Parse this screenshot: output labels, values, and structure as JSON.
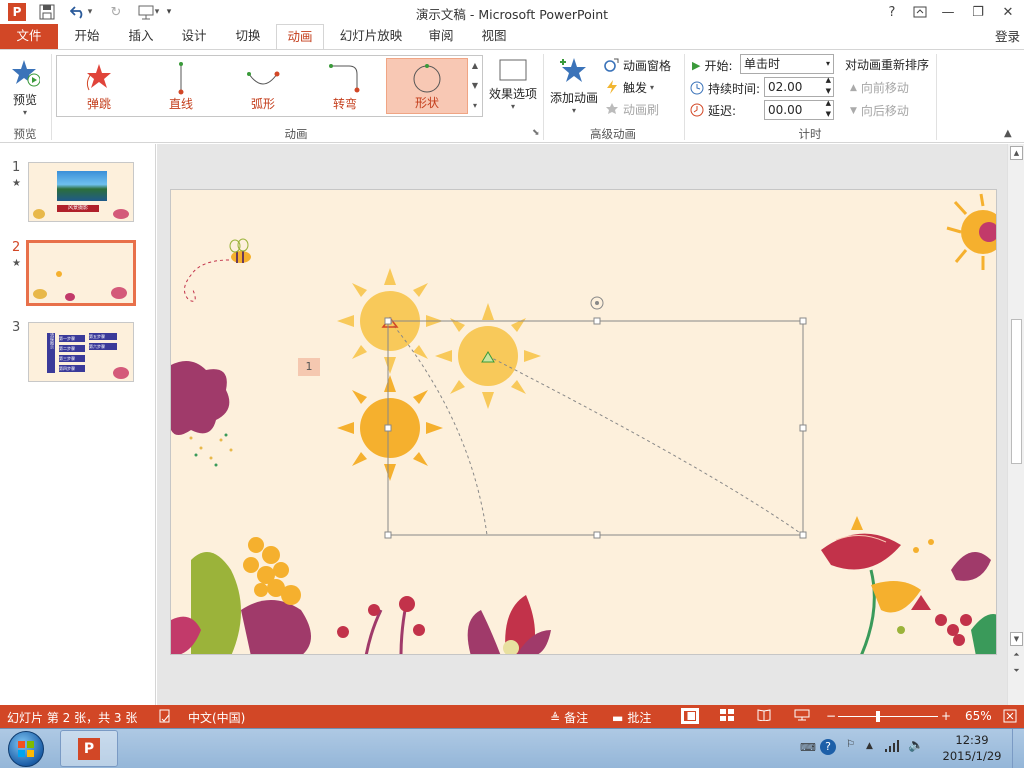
{
  "window": {
    "title": "演示文稿 - Microsoft PowerPoint",
    "help": "?",
    "minimize": "—",
    "restore": "❐",
    "close": "✕"
  },
  "qat": {
    "app_icon": "P",
    "save": "💾",
    "undo": "↶",
    "redo": "↻",
    "more": "▾"
  },
  "tabs": [
    "文件",
    "开始",
    "插入",
    "设计",
    "切换",
    "动画",
    "幻灯片放映",
    "审阅",
    "视图"
  ],
  "active_tab": "动画",
  "login": "登录",
  "ribbon": {
    "preview_label": "预览",
    "preview_group": "预览",
    "gallery": [
      {
        "label": "弹跳",
        "icon": "bounce-icon"
      },
      {
        "label": "直线",
        "icon": "line-path-icon"
      },
      {
        "label": "弧形",
        "icon": "arc-path-icon"
      },
      {
        "label": "转弯",
        "icon": "turn-path-icon"
      },
      {
        "label": "形状",
        "icon": "shape-path-icon"
      }
    ],
    "selected_gallery": "形状",
    "effect_options": "效果选项",
    "animation_group": "动画",
    "add_animation": "添加动画",
    "animation_pane": "动画窗格",
    "trigger": "触发",
    "animation_painter": "动画刷",
    "advanced_group": "高级动画",
    "start_label": "开始:",
    "start_value": "单击时",
    "duration_label": "持续时间:",
    "duration_value": "02.00",
    "delay_label": "延迟:",
    "delay_value": "00.00",
    "timing_group": "计时",
    "reorder_title": "对动画重新排序",
    "move_earlier": "向前移动",
    "move_later": "向后移动"
  },
  "slides": [
    {
      "number": "1",
      "star": "★",
      "banner": "风景摄影"
    },
    {
      "number": "2",
      "star": "★"
    },
    {
      "number": "3",
      "star": ""
    }
  ],
  "slide3_boxes": [
    "流程图示",
    "第一步骤",
    "第二步骤",
    "第三步骤",
    "第四步骤",
    "第五步骤",
    "第六步骤"
  ],
  "selected_slide": 2,
  "slide": {
    "anim_tag": "1"
  },
  "statusbar": {
    "slide_info": "幻灯片 第 2 张，共 3 张",
    "language": "中文(中国)",
    "notes": "备注",
    "comments": "批注",
    "zoom": "65%",
    "zoom_minus": "−",
    "zoom_plus": "+",
    "zoom_fraction": 0.4
  },
  "taskbar": {
    "time": "12:39",
    "date": "2015/1/29",
    "pp_icon": "P"
  },
  "colors": {
    "accent": "#d24726",
    "sun": "#f5b02e",
    "sun_light": "#f8c95a",
    "slide_bg": "#fdf0dc"
  }
}
